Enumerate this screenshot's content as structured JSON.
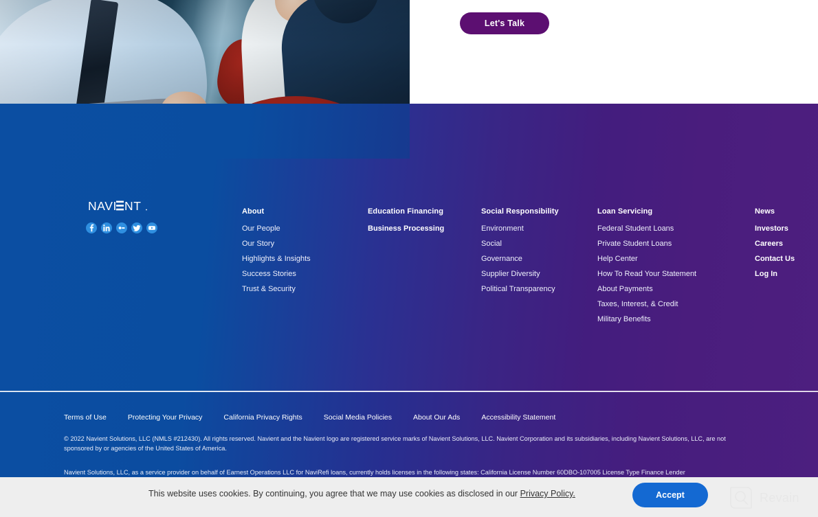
{
  "hero": {
    "photo_alt": "business-conversation-photo",
    "cta_label": "Let's Talk"
  },
  "colors": {
    "footer_gradient_start": "#0b4ea2",
    "footer_gradient_end": "#4d1f7f",
    "cta_purple": "#5c0f71",
    "accept_blue": "#1469d2",
    "social_icon_blue": "#2f8fe0",
    "cookie_bar_bg": "#eeeeee"
  },
  "footer": {
    "logo_text": "NAVIENT",
    "social": [
      {
        "name": "facebook-icon",
        "label": "Facebook"
      },
      {
        "name": "linkedin-icon",
        "label": "LinkedIn"
      },
      {
        "name": "glassdoor-icon",
        "label": "Glassdoor"
      },
      {
        "name": "twitter-icon",
        "label": "Twitter"
      },
      {
        "name": "youtube-icon",
        "label": "YouTube"
      }
    ],
    "columns": [
      {
        "heading": "About",
        "links": [
          "Our People",
          "Our Story",
          "Highlights & Insights",
          "Success Stories",
          "Trust & Security"
        ]
      },
      {
        "heading": "Education Financing",
        "links": [
          "Business Processing"
        ],
        "bold_links": true
      },
      {
        "heading": "Social Responsibility",
        "links": [
          "Environment",
          "Social",
          "Governance",
          "Supplier Diversity",
          "Political Transparency"
        ]
      },
      {
        "heading": "Loan Servicing",
        "links": [
          "Federal Student Loans",
          "Private Student Loans",
          "Help Center",
          "How To Read Your Statement",
          "About Payments",
          "Taxes, Interest, & Credit",
          "Military Benefits"
        ]
      },
      {
        "heading": "News",
        "links": [
          "Investors",
          "Careers",
          "Contact Us",
          "Log In"
        ],
        "bold_links": true
      }
    ]
  },
  "legal": {
    "links": [
      "Terms of Use",
      "Protecting Your Privacy",
      "California Privacy Rights",
      "Social Media Policies",
      "About Our Ads",
      "Accessibility Statement"
    ],
    "copyright": "© 2022 Navient Solutions, LLC (NMLS #212430). All rights reserved. Navient and the Navient logo are registered service marks of Navient Solutions, LLC. Navient Corporation and its subsidiaries, including Navient Solutions, LLC, are not sponsored by or agencies of the United States of America.",
    "extra": "Navient Solutions, LLC, as a service provider on behalf of Earnest Operations LLC for NaviRefi loans, currently holds licenses in the following states: California License Number 60DBO-107005 License Type Finance Lender"
  },
  "cookie": {
    "message": "This website uses cookies. By continuing, you agree that we may use cookies as disclosed in our ",
    "link_text": "Privacy Policy.",
    "accept_label": "Accept"
  },
  "watermark": {
    "brand": "Revain",
    "icon": "revain-logo-icon"
  }
}
